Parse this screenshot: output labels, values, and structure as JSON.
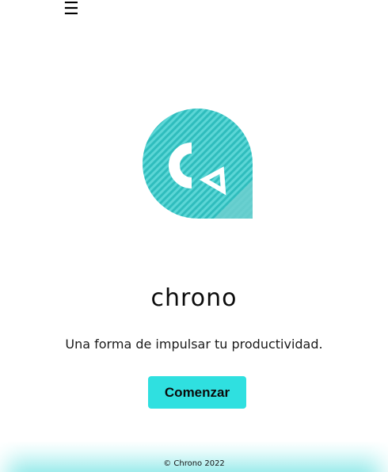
{
  "nav": {
    "menu_icon": "hamburger-menu-icon",
    "menu_glyph": "☰"
  },
  "logo": {
    "icon": "chrono-logo-icon",
    "accent_color": "#2fbdbd",
    "stripe_color": "#5cd6d6"
  },
  "hero": {
    "brand_name": "chrono",
    "tagline": "Una forma de impulsar tu productividad.",
    "cta_label": "Comenzar",
    "cta_color": "#2fe0e0"
  },
  "footer": {
    "text": "© Chrono 2022"
  }
}
